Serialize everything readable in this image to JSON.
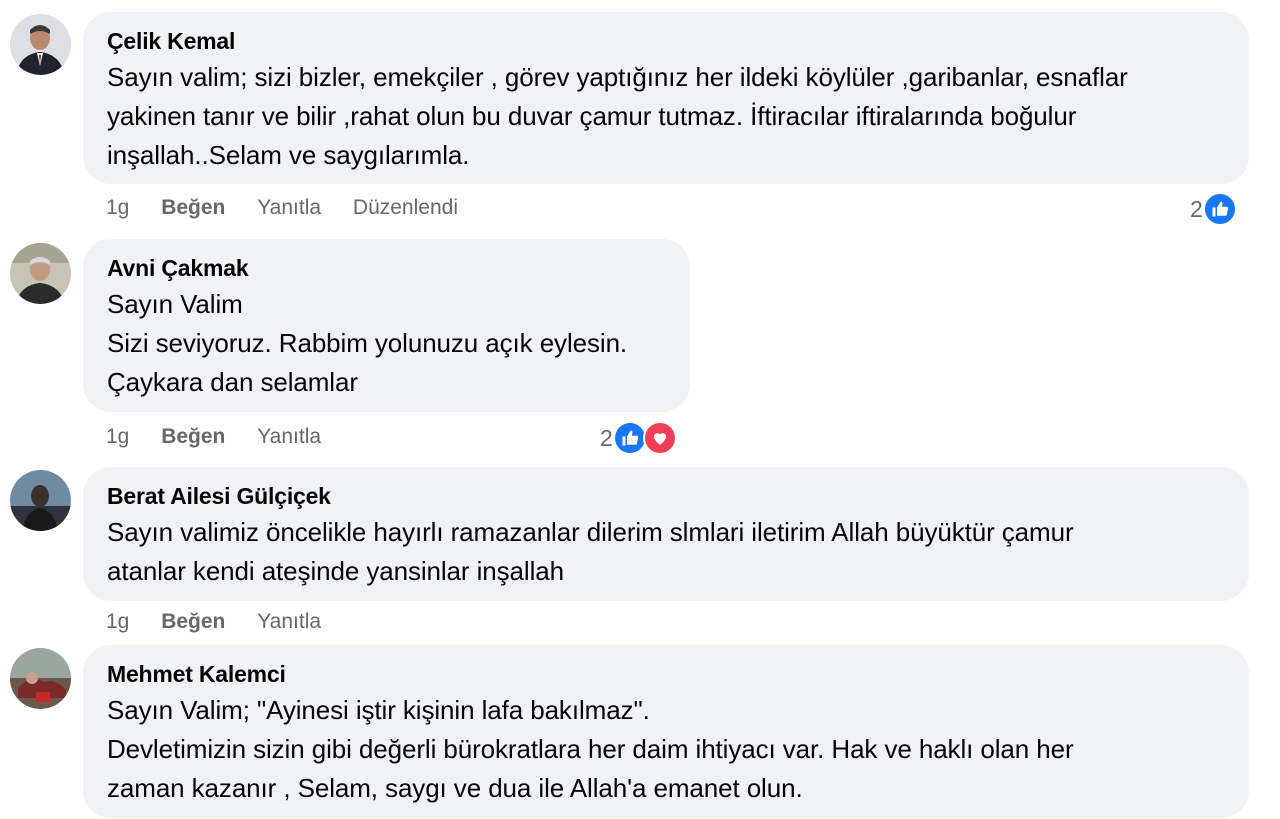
{
  "comments": [
    {
      "author": "Çelik Kemal",
      "lines": [
        "Sayın valim; sizi bizler, emekçiler , görev yaptığınız her ildeki köylüler ,garibanlar, esnaflar",
        "yakinen tanır ve bilir ,rahat olun bu duvar çamur tutmaz. İftiracılar iftiralarında boğulur",
        "inşallah..Selam ve saygılarımla."
      ],
      "time": "1g",
      "like_label": "Beğen",
      "reply_label": "Yanıtla",
      "edited_label": "Düzenlendi",
      "reaction_count": "2",
      "reaction_icons": [
        "like-icon"
      ]
    },
    {
      "author": "Avni Çakmak",
      "lines": [
        "Sayın Valim",
        "Sizi seviyoruz. Rabbim yolunuzu açık eylesin.",
        "Çaykara dan selamlar"
      ],
      "time": "1g",
      "like_label": "Beğen",
      "reply_label": "Yanıtla",
      "reaction_count": "2",
      "reaction_icons": [
        "like-icon",
        "love-icon"
      ]
    },
    {
      "author": "Berat Ailesi Gülçiçek",
      "lines": [
        "Sayın valimiz öncelikle hayırlı ramazanlar dilerim slmlari iletirim Allah büyüktür çamur",
        "atanlar kendi ateşinde yansinlar inşallah"
      ],
      "time": "1g",
      "like_label": "Beğen",
      "reply_label": "Yanıtla"
    },
    {
      "author": "Mehmet Kalemci",
      "lines": [
        "Sayın Valim; \"Ayinesi iştir kişinin lafa bakılmaz\".",
        "Devletimizin sizin gibi değerli bürokratlara her daim ihtiyacı var. Hak ve haklı olan her",
        "zaman kazanır , Selam, saygı ve dua ile Allah'a emanet olun."
      ]
    }
  ],
  "colors": {
    "bubble": "#f0f2f5",
    "secondary_text": "#65676b",
    "like_blue": "#1877f2",
    "love_red": "#f33e58"
  }
}
